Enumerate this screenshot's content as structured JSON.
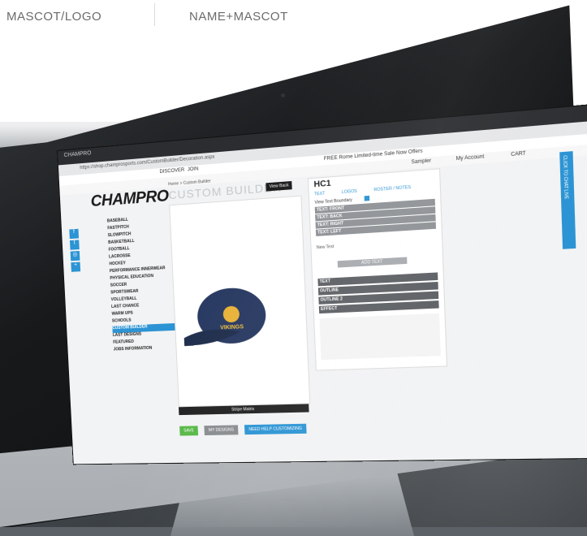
{
  "tabs": [
    {
      "label": "MASCOT/LOGO"
    },
    {
      "label": "NAME+MASCOT"
    }
  ],
  "browser": {
    "tab_title": "CHAMPRO",
    "url": "https://shop.champrosports.com/CustomBuilder/Decoration.aspx",
    "notice": "FREE Rome Limited-time Sale Now Offers"
  },
  "site": {
    "links": [
      "DISCOVER",
      "JOIN",
      "Sampler",
      "My Account",
      "CART"
    ]
  },
  "logo": "CHAMPRO",
  "menu": [
    "BASEBALL",
    "FASTPITCH",
    "SLOWPITCH",
    "BASKETBALL",
    "FOOTBALL",
    "LACROSSE",
    "HOCKEY",
    "PERFORMANCE INNERWEAR",
    "PHYSICAL EDUCATION",
    "SOCCER",
    "SPORTSWEAR",
    "VOLLEYBALL",
    "LAST CHANCE",
    "WARM UPS",
    "SCHOOLS",
    "CUSTOM BUILDER",
    "LAST DESIGNS",
    "FEATURED",
    "JOBS INFORMATION"
  ],
  "builder": {
    "crumb": "Home > Custom Builder",
    "title": "CUSTOM BUILDER",
    "view_back": "View Back",
    "stripe": "Stripe Matrix",
    "save": "SAVE",
    "my_designs": "MY DESIGNS",
    "help": "NEED HELP CUSTOMIZING"
  },
  "panel": {
    "title": "HC1",
    "subtabs": [
      "TEXT",
      "LOGOS",
      "ROSTER / NOTES"
    ],
    "boundary": "View Text Boundary",
    "positions": [
      "TEXT: FRONT",
      "TEXT: BACK",
      "TEXT: RIGHT",
      "TEXT: LEFT"
    ],
    "new_text": "New Text",
    "add_text": "ADD TEXT",
    "sections": [
      "TEXT",
      "OUTLINE",
      "OUTLINE 2",
      "EFFECT"
    ]
  },
  "sidetab": "CLICK TO CHAT LIVE",
  "cap_text": "VIKINGS",
  "colors": {
    "accent": "#2c94d4",
    "cap": "#2a3b63",
    "save": "#58b947"
  }
}
